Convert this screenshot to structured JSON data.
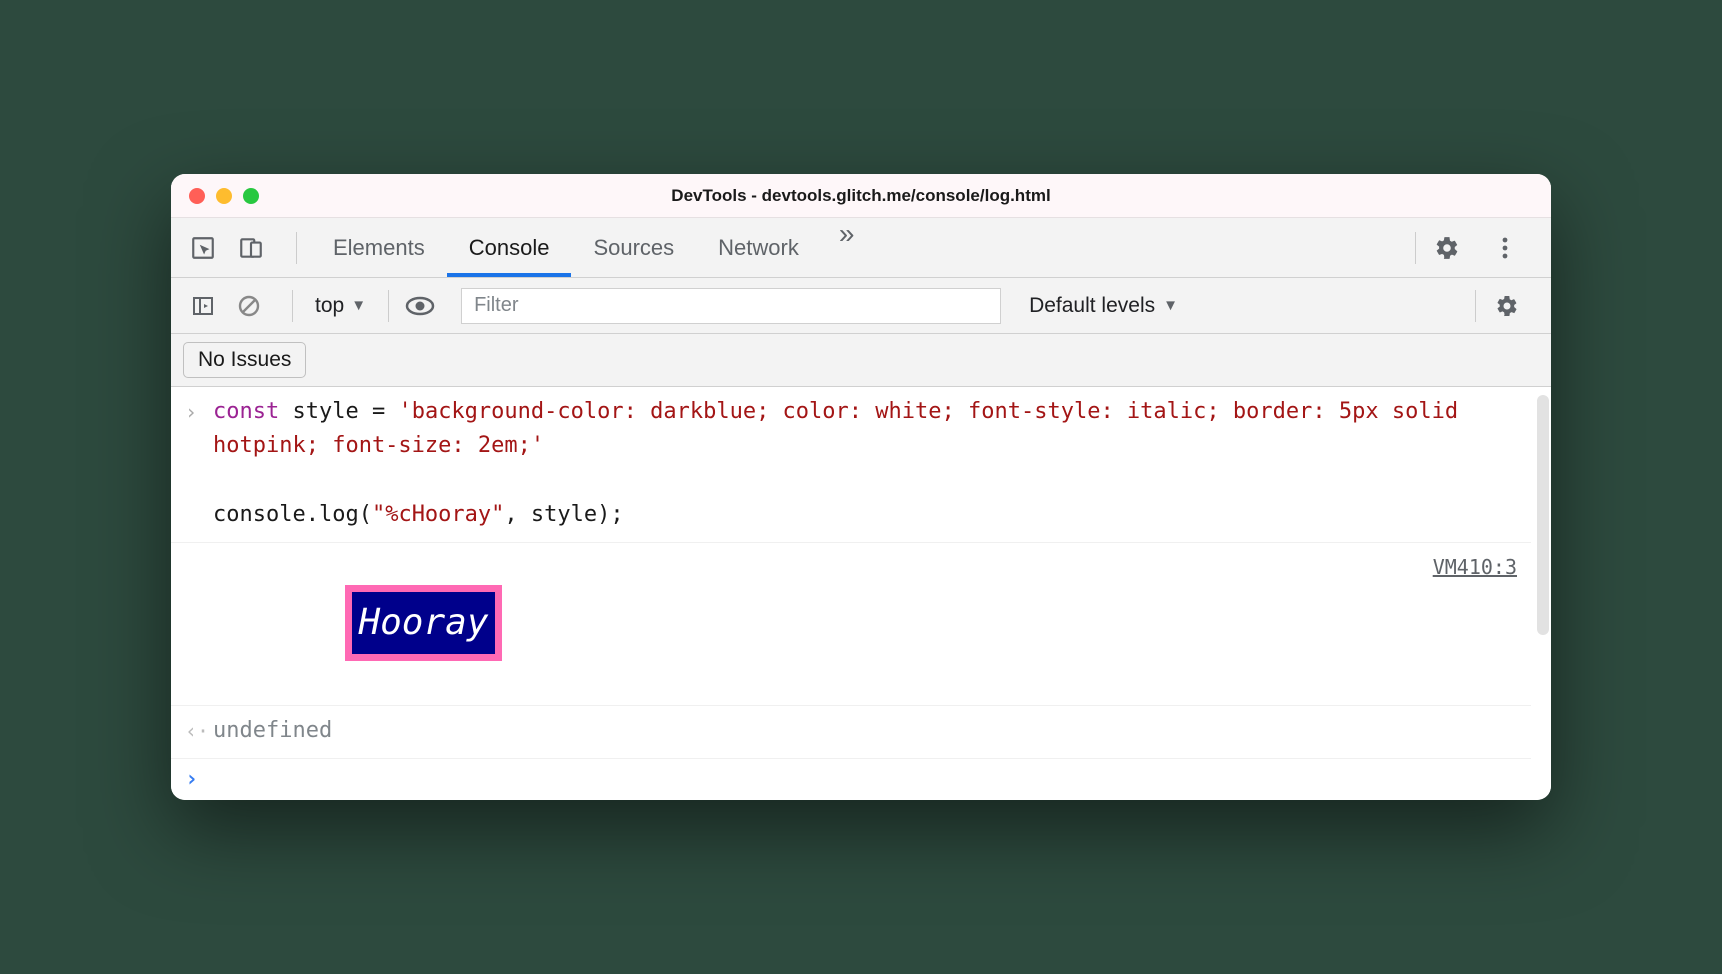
{
  "window": {
    "title": "DevTools - devtools.glitch.me/console/log.html"
  },
  "toolbar": {
    "tabs": [
      "Elements",
      "Console",
      "Sources",
      "Network"
    ],
    "activeTab": "Console"
  },
  "subtoolbar": {
    "context": "top",
    "filterPlaceholder": "Filter",
    "levels": "Default levels"
  },
  "issues": {
    "label": "No Issues"
  },
  "console": {
    "input": {
      "line1_kw": "const",
      "line1_var": " style = ",
      "line1_str": "'background-color: darkblue; color: white; font-style: italic; border: 5px solid hotpink; font-size: 2em;'",
      "line3_pln": "console.log(",
      "line3_str": "\"%cHooray\"",
      "line3_rest": ", style);"
    },
    "output": {
      "text": "Hooray",
      "source": "VM410:3"
    },
    "returnValue": "undefined"
  }
}
